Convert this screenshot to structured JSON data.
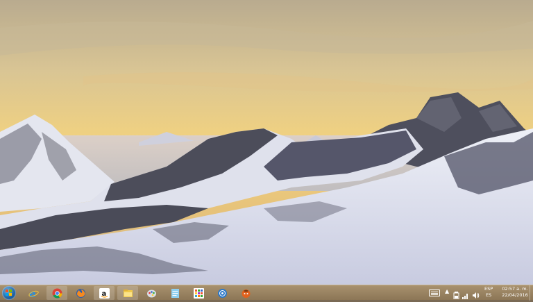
{
  "desktop": {
    "wallpaper": "snowy-mountains-sunset",
    "colors": {
      "sky_top": "#c9b896",
      "sky_glow": "#f0cf7e",
      "snow": "#dfe2ee",
      "rock": "#4e4f5c",
      "taskbar": "#9b8463"
    }
  },
  "taskbar": {
    "start_icon": "windows-start-orb",
    "pinned": [
      {
        "id": "ie",
        "icon": "internet-explorer-icon"
      },
      {
        "id": "chrome",
        "icon": "chrome-icon"
      },
      {
        "id": "firefox",
        "icon": "firefox-icon"
      },
      {
        "id": "amazon",
        "icon": "amazon-icon"
      },
      {
        "id": "explorer",
        "icon": "file-explorer-icon"
      },
      {
        "id": "paint",
        "icon": "paint-icon"
      },
      {
        "id": "notepad",
        "icon": "notepad-icon"
      },
      {
        "id": "store",
        "icon": "tiles-icon"
      },
      {
        "id": "media",
        "icon": "media-player-icon"
      },
      {
        "id": "game",
        "icon": "game-icon"
      }
    ],
    "tray": {
      "language_top": "ESP",
      "language_bottom": "ES",
      "time": "02:57 a. m.",
      "date": "22/04/2016"
    }
  }
}
